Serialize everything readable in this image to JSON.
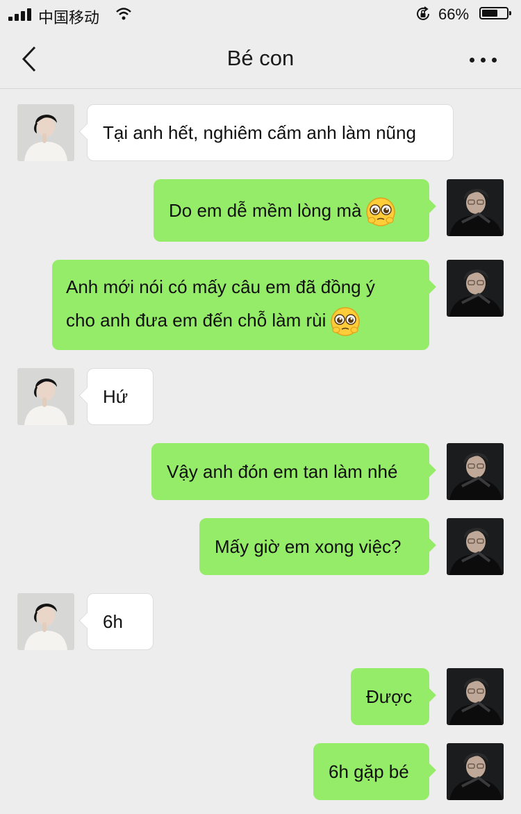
{
  "status_bar": {
    "carrier": "中国移动",
    "battery_percent": "66%",
    "battery_level": 0.66
  },
  "header": {
    "title": "Bé con"
  },
  "messages": [
    {
      "from": "contact",
      "text": "Tại anh hết, nghiêm cấm anh làm nũng"
    },
    {
      "from": "me",
      "text": "Do em dễ mềm lòng mà",
      "emoji": "pleading-face"
    },
    {
      "from": "me",
      "line1": "Anh mới nói có mấy câu em đã đồng ý",
      "line2": "cho anh đưa em đến chỗ làm rùi",
      "emoji": "pleading-face"
    },
    {
      "from": "contact",
      "text": "Hứ"
    },
    {
      "from": "me",
      "text": "Vậy anh đón em tan làm nhé"
    },
    {
      "from": "me",
      "text": "Mấy giờ em xong việc?"
    },
    {
      "from": "contact",
      "text": "6h"
    },
    {
      "from": "me",
      "text": "Được"
    },
    {
      "from": "me",
      "text": "6h gặp bé"
    }
  ],
  "colors": {
    "background": "#ededed",
    "outgoing_bubble": "#95ec69",
    "incoming_bubble": "#ffffff"
  }
}
